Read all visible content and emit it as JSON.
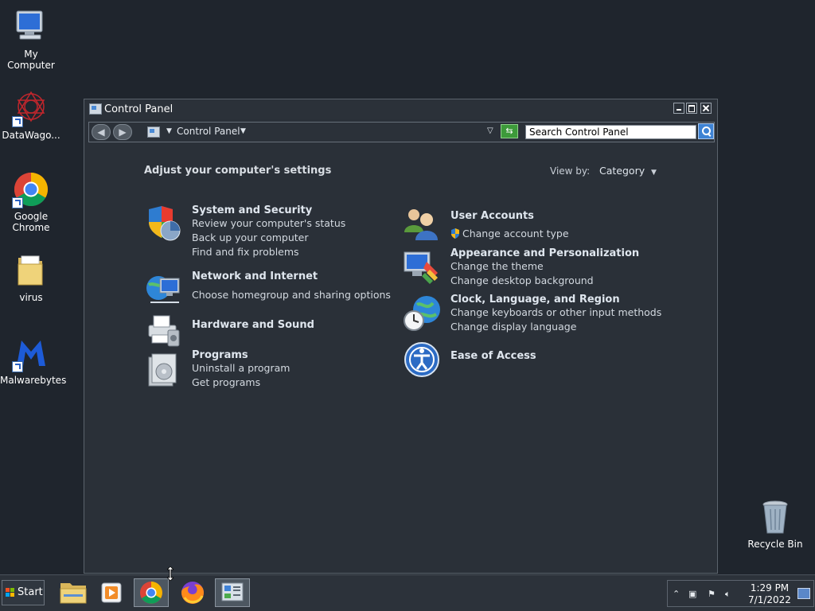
{
  "desktop": {
    "icons": [
      {
        "label": "My Computer"
      },
      {
        "label": "DataWago..."
      },
      {
        "label": "Google Chrome"
      },
      {
        "label": "virus"
      },
      {
        "label": "Malwarebytes"
      },
      {
        "label": "Recycle Bin"
      }
    ]
  },
  "window": {
    "title": "Control Panel",
    "address": "Control Panel",
    "search_value": "Search Control Panel",
    "heading": "Adjust your computer's settings",
    "view_by_label": "View by:",
    "view_by_value": "Category",
    "categories": [
      {
        "title": "System and Security",
        "links": [
          "Review your computer's status",
          "Back up your computer",
          "Find and fix problems"
        ],
        "icon": "shield-icon"
      },
      {
        "title": "Network and Internet",
        "links": [
          "Choose homegroup and sharing options"
        ],
        "icon": "network-icon"
      },
      {
        "title": "Hardware and Sound",
        "links": [],
        "icon": "printer-icon"
      },
      {
        "title": "Programs",
        "links": [
          "Uninstall a program",
          "Get programs"
        ],
        "icon": "programs-icon"
      },
      {
        "title": "User Accounts",
        "links": [
          "Change account type"
        ],
        "icon": "users-icon"
      },
      {
        "title": "Appearance and Personalization",
        "links": [
          "Change the theme",
          "Change desktop background"
        ],
        "icon": "monitor-paint-icon"
      },
      {
        "title": "Clock, Language, and Region",
        "links": [
          "Change keyboards or other input methods",
          "Change display language"
        ],
        "icon": "globe-clock-icon"
      },
      {
        "title": "Ease of Access",
        "links": [],
        "icon": "ease-of-access-icon"
      }
    ]
  },
  "taskbar": {
    "start_label": "Start",
    "clock_time": "1:29 PM",
    "clock_date": "7/1/2022"
  },
  "colors": {
    "desktop_bg": "#1f252d",
    "window_bg": "#2a3038",
    "taskbar_bg": "#2c323a"
  }
}
